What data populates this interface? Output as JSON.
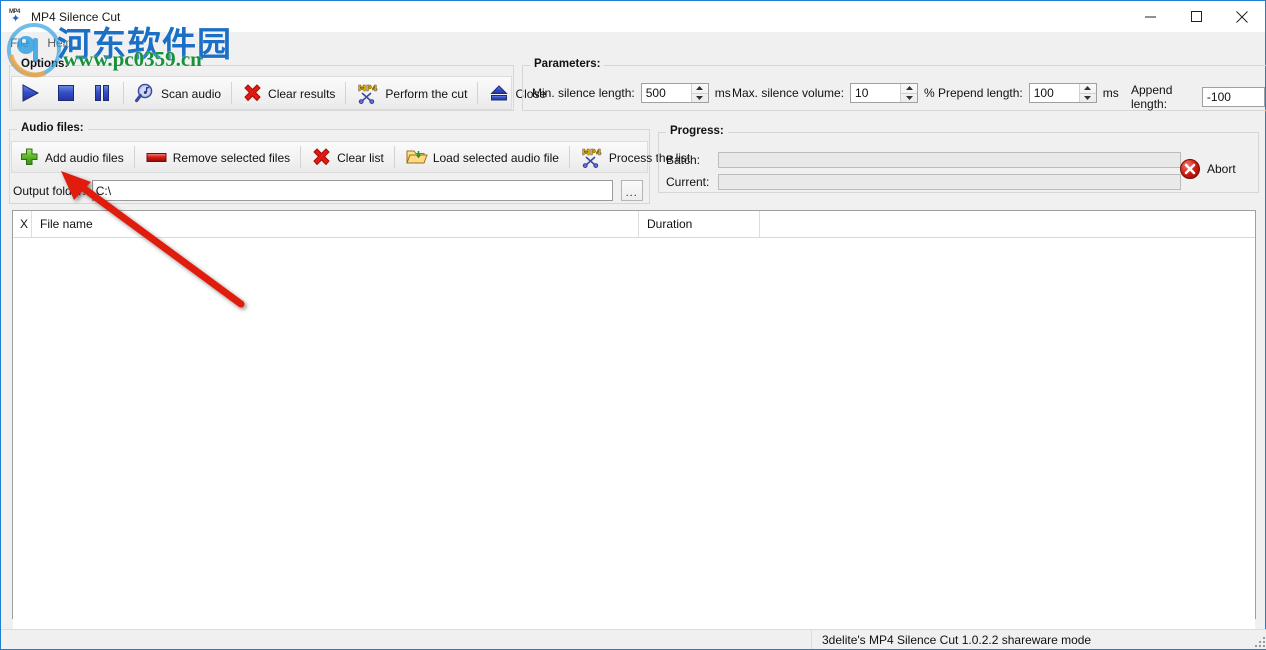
{
  "window": {
    "title": "MP4 Silence Cut",
    "icon": "mp4-app-icon",
    "controls": {
      "minimize": "minimize-icon",
      "maximize": "maximize-icon",
      "close": "close-icon"
    }
  },
  "menu": {
    "items": [
      {
        "label": "File"
      },
      {
        "label": "Help"
      }
    ]
  },
  "options_group": {
    "title": "Options:",
    "toolbar": [
      {
        "id": "play",
        "icon": "play-icon",
        "label": ""
      },
      {
        "id": "stop",
        "icon": "stop-icon",
        "label": ""
      },
      {
        "id": "pause",
        "icon": "pause-icon",
        "label": ""
      },
      {
        "id": "scan-audio",
        "icon": "magnifier-music-icon",
        "label": "Scan audio"
      },
      {
        "id": "clear-results",
        "icon": "red-x-icon",
        "label": "Clear results"
      },
      {
        "id": "perform-cut",
        "icon": "mp4-scissors-icon",
        "label": "Perform the cut"
      },
      {
        "id": "close",
        "icon": "eject-icon",
        "label": "Close"
      }
    ]
  },
  "parameters_group": {
    "title": "Parameters:",
    "fields": [
      {
        "id": "min-silence-length",
        "label": "Min. silence length:",
        "value": "500",
        "unit": "ms",
        "spinner": true
      },
      {
        "id": "max-silence-volume",
        "label": "Max. silence volume:",
        "value": "10",
        "unit": "%",
        "spinner": true
      },
      {
        "id": "prepend-length",
        "label": "Prepend length:",
        "value": "100",
        "unit": "ms",
        "spinner": true
      },
      {
        "id": "append-length",
        "label": "Append length:",
        "value": "-100",
        "unit": "",
        "spinner": false
      }
    ]
  },
  "audio_files_group": {
    "title": "Audio files:",
    "toolbar": [
      {
        "id": "add-audio-files",
        "icon": "green-plus-icon",
        "label": "Add audio files"
      },
      {
        "id": "remove-selected-files",
        "icon": "red-bar-icon",
        "label": "Remove selected files"
      },
      {
        "id": "clear-list",
        "icon": "red-x-icon",
        "label": "Clear list"
      },
      {
        "id": "load-selected-audio-file",
        "icon": "folder-open-icon",
        "label": "Load selected audio file"
      },
      {
        "id": "process-the-list",
        "icon": "mp4-scissors-icon",
        "label": "Process the list"
      }
    ],
    "output_folder": {
      "label": "Output folder:",
      "value": "C:\\",
      "placeholder": "",
      "browse_label": "..."
    }
  },
  "progress_group": {
    "title": "Progress:",
    "rows": [
      {
        "id": "batch",
        "label": "Batch:",
        "value": 0
      },
      {
        "id": "current",
        "label": "Current:",
        "value": 0
      }
    ],
    "abort": {
      "icon": "red-circle-x-icon",
      "label": "Abort"
    }
  },
  "file_list": {
    "columns": [
      {
        "id": "x",
        "label": "X"
      },
      {
        "id": "filename",
        "label": "File name"
      },
      {
        "id": "duration",
        "label": "Duration"
      },
      {
        "id": "extra",
        "label": ""
      }
    ],
    "rows": []
  },
  "statusbar": {
    "text": "3delite's MP4 Silence Cut 1.0.2.2 shareware mode"
  },
  "watermark": {
    "site_name_cn": "河东软件园",
    "site_url": "www.pc0359.cn",
    "logo": "pc0359-logo-icon"
  },
  "annotation": {
    "type": "red-arrow",
    "color": "#e01b10",
    "points_to": "add-audio-files"
  },
  "colors": {
    "accent_blue": "#1f7fd0",
    "icon_blue": "#2a43b4",
    "icon_red": "#d81b14",
    "icon_green": "#4aa528",
    "watermark_blue": "#1b6fc4",
    "watermark_green": "#17913a"
  }
}
